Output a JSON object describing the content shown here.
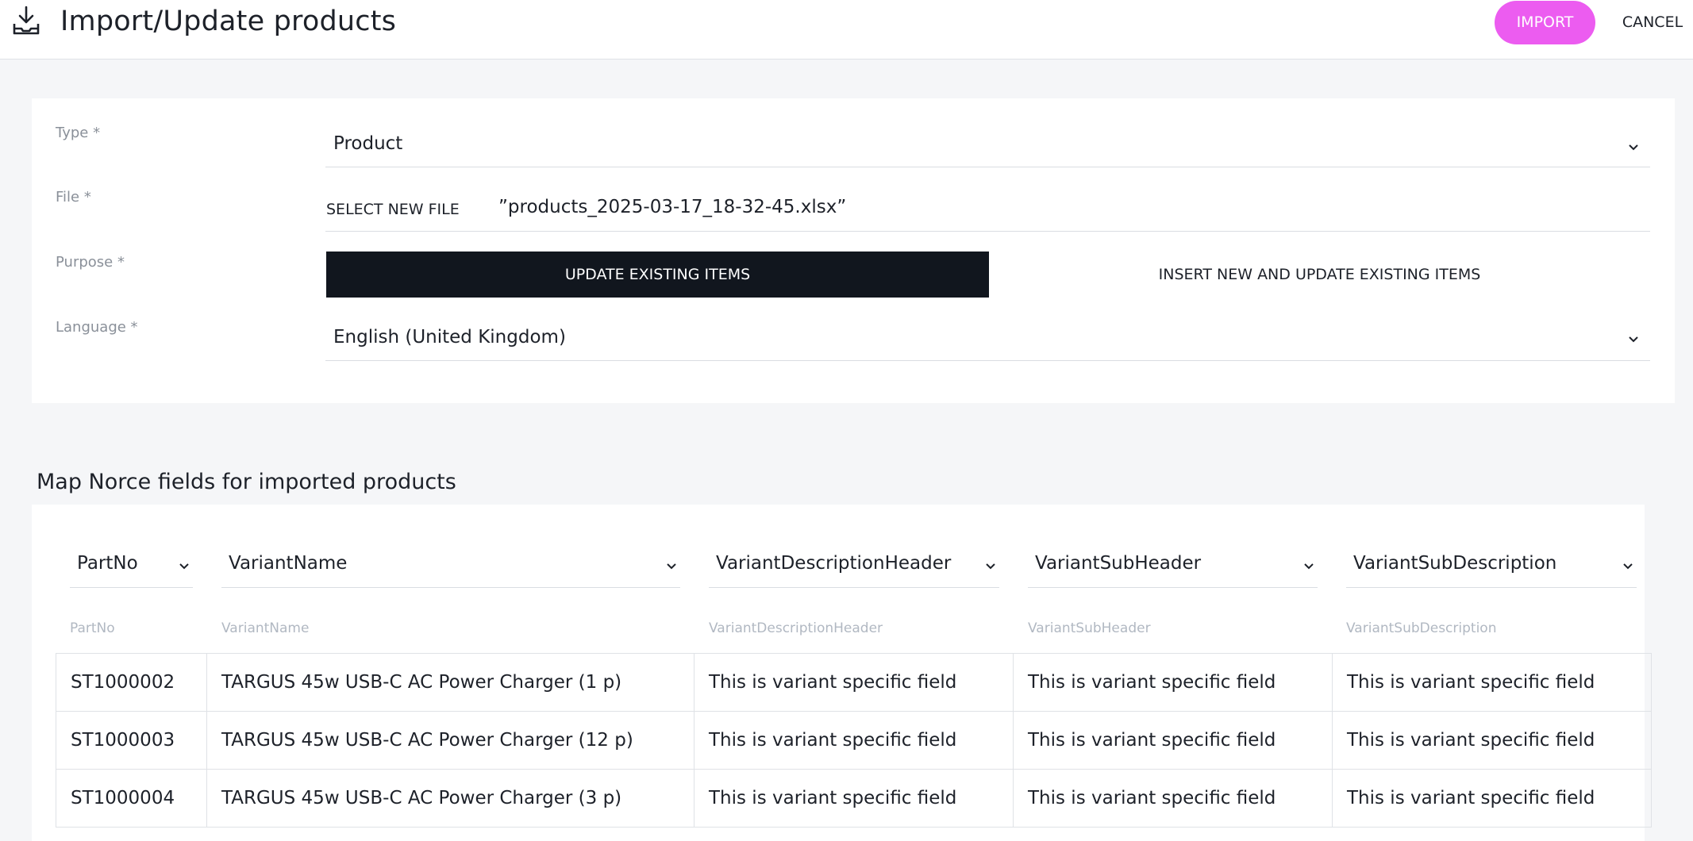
{
  "header": {
    "title": "Import/Update products",
    "icon": "import-download-icon",
    "import_label": "IMPORT",
    "cancel_label": "CANCEL",
    "accent_color": "#ec5cf0"
  },
  "form": {
    "type": {
      "label": "Type *",
      "value": "Product"
    },
    "file": {
      "label": "File *",
      "select_label": "SELECT NEW FILE",
      "file_name": "”products_2025-03-17_18-32-45.xlsx”"
    },
    "purpose": {
      "label": "Purpose *",
      "options": [
        "UPDATE EXISTING ITEMS",
        "INSERT NEW AND UPDATE EXISTING ITEMS"
      ],
      "selected": "UPDATE EXISTING ITEMS"
    },
    "language": {
      "label": "Language *",
      "value": "English (United Kingdom)"
    }
  },
  "mapping": {
    "title": "Map Norce fields for imported products",
    "field_selects": [
      "PartNo",
      "VariantName",
      "VariantDescriptionHeader",
      "VariantSubHeader",
      "VariantSubDescription"
    ],
    "column_headers": [
      "PartNo",
      "VariantName",
      "VariantDescriptionHeader",
      "VariantSubHeader",
      "VariantSubDescription"
    ],
    "rows": [
      [
        "ST1000002",
        "TARGUS 45w USB-C AC Power Charger (1 p)",
        "This is variant specific field",
        "This is variant specific field",
        "This is variant specific field"
      ],
      [
        "ST1000003",
        "TARGUS 45w USB-C AC Power Charger (12 p)",
        "This is variant specific field",
        "This is variant specific field",
        "This is variant specific field"
      ],
      [
        "ST1000004",
        "TARGUS 45w USB-C AC Power Charger (3 p)",
        "This is variant specific field",
        "This is variant specific field",
        "This is variant specific field"
      ]
    ]
  }
}
